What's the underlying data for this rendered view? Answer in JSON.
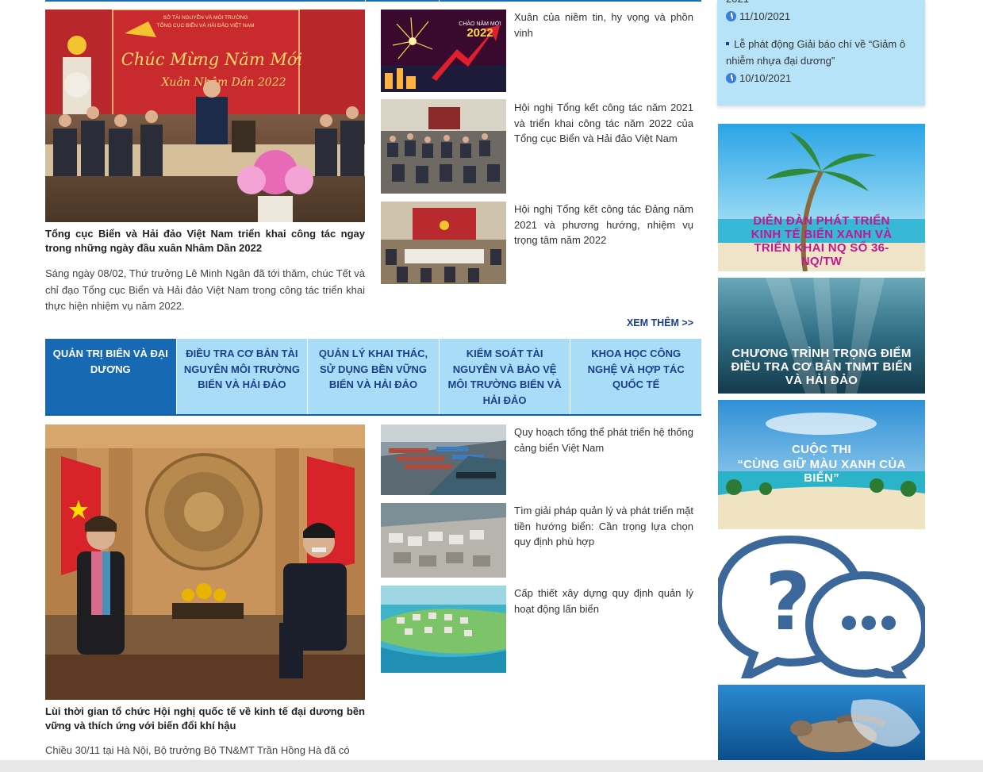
{
  "featured_top": {
    "title": "Tổng cục Biển và Hải đảo Việt Nam triển khai công tác ngay trong những ngày đầu xuân Nhâm Dần 2022",
    "summary": "Sáng ngày 08/02, Thứ trưởng Lê Minh Ngân đã tới thăm, chúc Tết và chỉ đạo Tổng cục Biển và Hải đảo Việt Nam trong công tác triển khai thực hiện nhiệm vụ năm 2022.",
    "image_banner_line1": "SỞ TÀI NGUYÊN VÀ MÔI TRƯỜNG",
    "image_banner_line2": "TỔNG CỤC BIỂN VÀ HẢI ĐẢO VIỆT NAM",
    "image_banner_script1": "Chúc Mừng Năm Mới",
    "image_banner_script2": "Xuân Nhâm Dần 2022"
  },
  "side_news_top": [
    {
      "title": "Xuân của niềm tin, hy vọng và phồn vinh",
      "thumb_caption": "CHÀO NĂM MỚI",
      "thumb_year": "2022"
    },
    {
      "title": "Hội nghị Tổng kết công tác năm 2021 và triển khai công tác năm 2022 của Tổng cục Biển và Hải đảo Việt Nam"
    },
    {
      "title": "Hội nghị Tổng kết công tác Đảng năm 2021 và phương hướng, nhiệm vụ trọng tâm năm 2022"
    }
  ],
  "more_link": "XEM THÊM >>",
  "tabs": [
    {
      "label": "QUẢN TRỊ BIỂN VÀ ĐẠI DƯƠNG",
      "active": true
    },
    {
      "label": "ĐIỀU TRA CƠ BẢN TÀI NGUYÊN MÔI TRƯỜNG BIỂN VÀ HẢI ĐẢO",
      "active": false
    },
    {
      "label": "QUẢN LÝ KHAI THÁC, SỬ DỤNG BỀN VỮNG BIỂN VÀ HẢI ĐẢO",
      "active": false
    },
    {
      "label": "KIỂM SOÁT TÀI NGUYÊN VÀ BẢO VỆ MÔI TRƯỜNG BIỂN VÀ HẢI ĐẢO",
      "active": false
    },
    {
      "label": "KHOA HỌC CÔNG NGHỆ VÀ HỢP TÁC QUỐC TẾ",
      "active": false
    }
  ],
  "featured_bottom": {
    "title": "Lùi thời gian tổ chức Hội nghị quốc tế về kinh tế đại dương bền vững và thích ứng với biến đổi khí hậu",
    "summary": "Chiều 30/11 tại Hà Nội, Bộ trưởng Bộ TN&MT Trần Hồng Hà đã có"
  },
  "side_news_bottom": [
    {
      "title": "Quy hoạch tổng thể phát triển hệ thống cảng biển Việt Nam"
    },
    {
      "title": "Tìm giải pháp quản lý và phát triển mặt tiền hướng biển: Cần trọng lựa chọn quy định phù hợp"
    },
    {
      "title": "Cấp thiết xây dựng quy định quản lý hoạt động lấn biển"
    }
  ],
  "news_box": {
    "partial_top": "2021",
    "items": [
      {
        "date": "11/10/2021"
      },
      {
        "title": "Lễ phát động Giải báo chí về “Giảm ô nhiễm nhựa đại dương”",
        "date": "10/10/2021"
      }
    ]
  },
  "banners": [
    {
      "text": "DIỄN ĐÀN PHÁT TRIỂN KINH TẾ BIỂN XANH VÀ TRIỂN KHAI NQ SỐ 36-NQ/TW",
      "text_color": "#c2188f"
    },
    {
      "text": "CHƯƠNG TRÌNH TRỌNG ĐIỂM ĐIỀU TRA CƠ BẢN TNMT BIỂN VÀ HẢI ĐẢO",
      "text_color": "#ffffff"
    },
    {
      "text_line1": "CUỘC THI",
      "text_line2": "“CÙNG GIỮ MÀU XANH CỦA BIỂN”",
      "text_color": "#ffffff"
    },
    {
      "icon": "question-chat-icon"
    },
    {
      "icon": "turtle-plastic-image"
    }
  ],
  "colors": {
    "tab_active": "#1669b2",
    "tab_inactive": "#a9dcf6",
    "tab_text": "#1d3f8a",
    "news_box_bg": "#b6e3f7"
  }
}
